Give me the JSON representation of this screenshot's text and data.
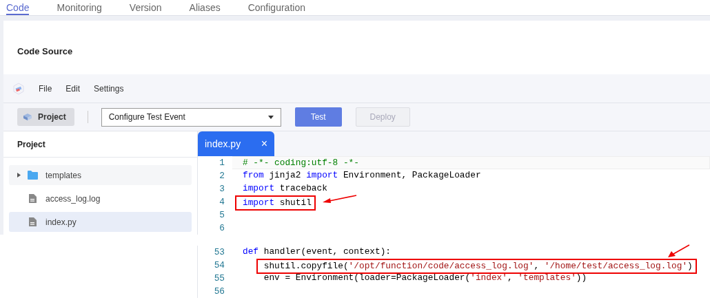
{
  "tabs": [
    {
      "label": "Code",
      "selected": true
    },
    {
      "label": "Monitoring",
      "selected": false
    },
    {
      "label": "Version",
      "selected": false
    },
    {
      "label": "Aliases",
      "selected": false
    },
    {
      "label": "Configuration",
      "selected": false
    }
  ],
  "section_title": "Code Source",
  "menu": [
    "File",
    "Edit",
    "Settings"
  ],
  "toolbar": {
    "project_button": "Project",
    "event_select": {
      "value": "Configure Test Event"
    },
    "test_button": {
      "label": "Test",
      "disabled": false
    },
    "deploy_button": {
      "label": "Deploy",
      "disabled": true
    }
  },
  "project_panel": {
    "title": "Project",
    "items": [
      {
        "kind": "folder",
        "name": "templates",
        "expanded": false,
        "selected": false
      },
      {
        "kind": "file",
        "name": "access_log.log",
        "selected": false
      },
      {
        "kind": "file",
        "name": "index.py",
        "selected": true
      }
    ]
  },
  "editor": {
    "tabs": [
      {
        "label": "index.py",
        "close": "×",
        "selected": true
      }
    ],
    "segments": [
      {
        "lines": [
          {
            "number": "1",
            "current": true,
            "tokens": [
              {
                "kind": "comment",
                "text": "# -*- coding:utf-8 -*-"
              }
            ]
          },
          {
            "number": "2",
            "current": false,
            "tokens": [
              {
                "kind": "keyword",
                "text": "from"
              },
              {
                "kind": "plain",
                "text": " jinja2 "
              },
              {
                "kind": "keyword",
                "text": "import"
              },
              {
                "kind": "plain",
                "text": " Environment, PackageLoader"
              }
            ]
          },
          {
            "number": "3",
            "current": false,
            "tokens": [
              {
                "kind": "keyword",
                "text": "import"
              },
              {
                "kind": "plain",
                "text": " traceback"
              }
            ]
          },
          {
            "number": "4",
            "current": false,
            "annotation": {
              "kind": "side"
            },
            "tokens": [
              {
                "kind": "keyword",
                "text": "import"
              },
              {
                "kind": "plain",
                "text": " shutil"
              }
            ]
          },
          {
            "number": "5",
            "current": false
          },
          {
            "number": "6",
            "current": false
          }
        ]
      },
      {
        "lines": [
          {
            "number": "53",
            "current": false,
            "tokens": [
              {
                "kind": "keyword",
                "text": "def"
              },
              {
                "kind": "plain",
                "text": " handler(event, context):"
              }
            ]
          },
          {
            "number": "54",
            "current": false,
            "annotation": {
              "kind": "above"
            },
            "tokens": [
              {
                "kind": "plain",
                "text": "    shutil.copyfile("
              },
              {
                "kind": "string",
                "text": "'/opt/function/code/access_log.log'"
              },
              {
                "kind": "plain",
                "text": ", "
              },
              {
                "kind": "string",
                "text": "'/home/test/access_log.log'"
              },
              {
                "kind": "plain",
                "text": ")"
              }
            ]
          },
          {
            "number": "55",
            "current": false,
            "tokens": [
              {
                "kind": "plain",
                "text": "    env = Environment(loader=PackageLoader("
              },
              {
                "kind": "string",
                "text": "'index'"
              },
              {
                "kind": "plain",
                "text": ", "
              },
              {
                "kind": "string",
                "text": "'templates'"
              },
              {
                "kind": "plain",
                "text": "))"
              }
            ]
          },
          {
            "number": "56",
            "current": false
          }
        ]
      }
    ]
  }
}
